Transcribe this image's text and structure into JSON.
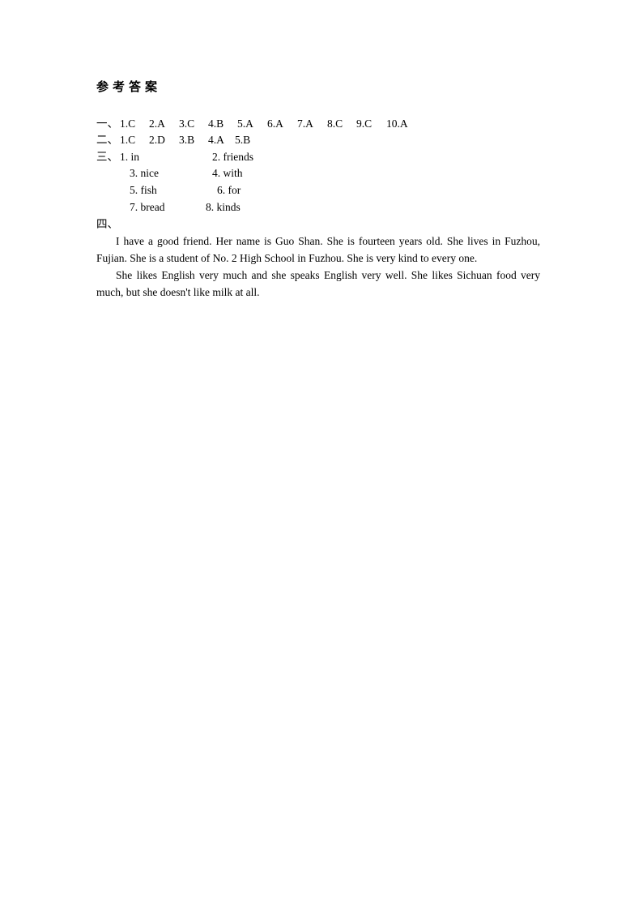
{
  "title": "参考答案",
  "section1": {
    "label": "一、",
    "answers": [
      "1.C",
      "2.A",
      "3.C",
      "4.B",
      "5.A",
      "6.A",
      "7.A",
      "8.C",
      "9.C",
      "10.A"
    ]
  },
  "section2": {
    "label": "二、",
    "answers": [
      "1.C",
      "2.D",
      "3.B",
      "4.A",
      "5.B"
    ]
  },
  "section3": {
    "label": "三、",
    "answers": [
      "1. in",
      "2. friends",
      "3. nice",
      "4. with",
      "5. fish",
      "6. for",
      "7. bread",
      "8. kinds"
    ]
  },
  "section4": {
    "label": "四、",
    "paragraphs": [
      "I have a good friend. Her name is Guo Shan. She is fourteen years old. She lives in Fuzhou, Fujian. She is a student of No. 2 High School in Fuzhou. She is very kind to every one.",
      "She likes English very much and she speaks English very well. She likes Sichuan food very much, but she doesn't like milk at all."
    ]
  }
}
